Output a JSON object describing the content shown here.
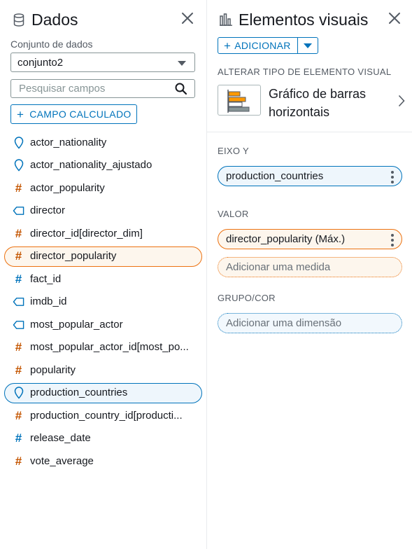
{
  "data_panel": {
    "title": "Dados",
    "dataset_label": "Conjunto de dados",
    "dataset_value": "conjunto2",
    "search_placeholder": "Pesquisar campos",
    "calc_field_label": "CAMPO CALCULADO",
    "fields": [
      {
        "label": "actor_nationality",
        "icon": "location-icon"
      },
      {
        "label": "actor_nationality_ajustado",
        "icon": "location-icon"
      },
      {
        "label": "actor_popularity",
        "icon": "measure-hash-icon"
      },
      {
        "label": "director",
        "icon": "dimension-tag-icon"
      },
      {
        "label": "director_id[director_dim]",
        "icon": "measure-hash-icon"
      },
      {
        "label": "director_popularity",
        "icon": "measure-hash-icon"
      },
      {
        "label": "fact_id",
        "icon": "dimension-hash-icon"
      },
      {
        "label": "imdb_id",
        "icon": "dimension-tag-icon"
      },
      {
        "label": "most_popular_actor",
        "icon": "dimension-tag-icon"
      },
      {
        "label": "most_popular_actor_id[most_po...",
        "icon": "measure-hash-icon"
      },
      {
        "label": "popularity",
        "icon": "measure-hash-icon"
      },
      {
        "label": "production_countries",
        "icon": "location-icon"
      },
      {
        "label": "production_country_id[producti...",
        "icon": "measure-hash-icon"
      },
      {
        "label": "release_date",
        "icon": "dimension-hash-icon"
      },
      {
        "label": "vote_average",
        "icon": "measure-hash-icon"
      }
    ]
  },
  "visuals_panel": {
    "title": "Elementos visuais",
    "add_label": "ADICIONAR",
    "change_type_label": "ALTERAR TIPO DE ELEMENTO VISUAL",
    "visual_type_line1": "Gráfico de barras",
    "visual_type_line2": "horizontais",
    "y_axis_label": "EIXO Y",
    "y_axis_field": "production_countries",
    "value_label": "VALOR",
    "value_field": "director_popularity (Máx.)",
    "add_measure": "Adicionar uma medida",
    "group_label": "GRUPO/COR",
    "add_dimension": "Adicionar uma dimensão"
  },
  "colors": {
    "accent_blue": "#0073bb",
    "accent_orange": "#ec7211",
    "measure_orange": "#c45500",
    "text_dark": "#16191f",
    "text_muted": "#545b64"
  }
}
